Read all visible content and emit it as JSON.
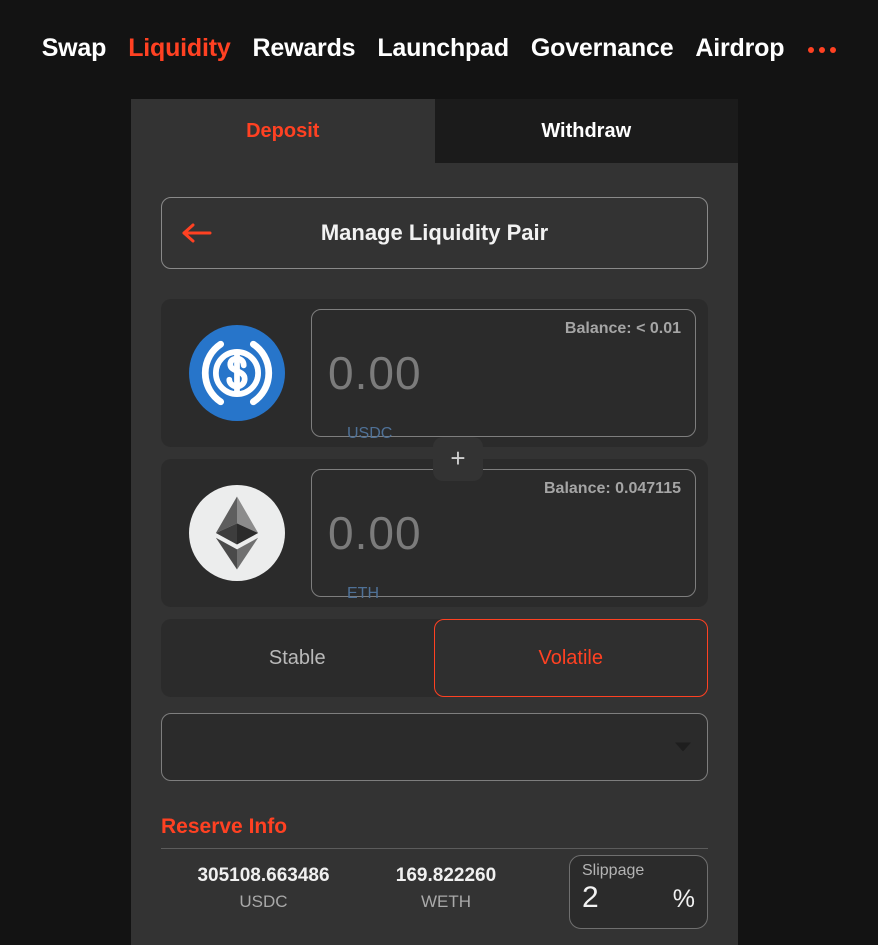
{
  "nav": {
    "items": [
      {
        "label": "Swap",
        "active": false
      },
      {
        "label": "Liquidity",
        "active": true
      },
      {
        "label": "Rewards",
        "active": false
      },
      {
        "label": "Launchpad",
        "active": false
      },
      {
        "label": "Governance",
        "active": false
      },
      {
        "label": "Airdrop",
        "active": false
      }
    ],
    "more_icon": "ellipsis-icon"
  },
  "tabs": {
    "deposit": "Deposit",
    "withdraw": "Withdraw",
    "active": "Deposit"
  },
  "header": {
    "title": "Manage Liquidity Pair",
    "back_icon": "arrow-left-icon"
  },
  "tokens": [
    {
      "icon": "usdc-icon",
      "symbol": "USDC",
      "amount": "0.00",
      "balance": "Balance: < 0.01"
    },
    {
      "icon": "eth-icon",
      "symbol": "ETH",
      "amount": "0.00",
      "balance": "Balance: 0.047115"
    }
  ],
  "add_button": {
    "icon": "plus-icon",
    "label": "+"
  },
  "pool_type": {
    "stable": "Stable",
    "volatile": "Volatile",
    "selected": "Volatile"
  },
  "pair_select": {
    "value": "",
    "placeholder": "",
    "caret_icon": "chevron-down-icon"
  },
  "reserve": {
    "title": "Reserve Info",
    "items": [
      {
        "value": "305108.663486",
        "symbol": "USDC"
      },
      {
        "value": "169.822260",
        "symbol": "WETH"
      }
    ]
  },
  "slippage": {
    "label": "Slippage",
    "value": "2",
    "unit": "%"
  },
  "colors": {
    "accent": "#ff4122",
    "page_bg": "#131313",
    "card_bg": "#333333",
    "row_bg": "#2b2b2b",
    "tab_inactive_bg": "#1b1b1b",
    "token_label": "#4f7197",
    "usdc_blue": "#2775ca"
  }
}
